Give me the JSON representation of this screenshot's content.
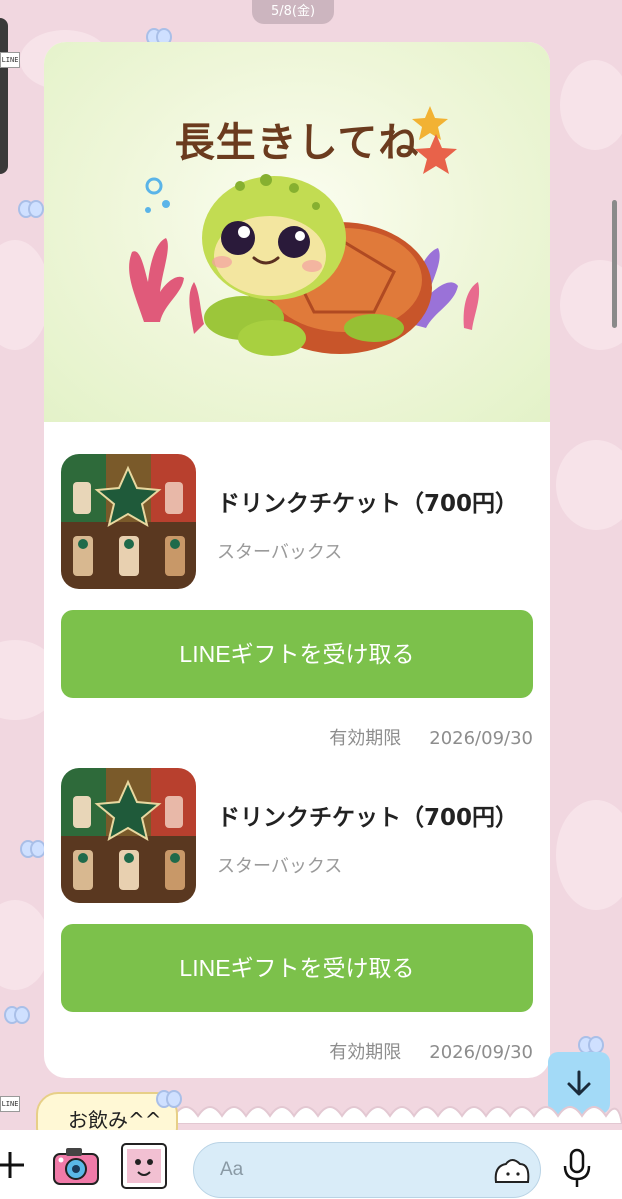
{
  "header": {
    "date": "5/8(金)"
  },
  "side_label": "LINE",
  "card": {
    "hero_title": "長生きしてね",
    "items": [
      {
        "title": "ドリンクチケット（700円）",
        "brand": "スターバックス",
        "button_label": "LINEギフトを受け取る",
        "expiry_label": "有効期限",
        "expiry_date": "2026/09/30"
      },
      {
        "title": "ドリンクチケット（700円）",
        "brand": "スターバックス",
        "button_label": "LINEギフトを受け取る",
        "expiry_label": "有効期限",
        "expiry_date": "2026/09/30"
      }
    ]
  },
  "bubble": {
    "text": "お飲み^^"
  },
  "input": {
    "placeholder": "Aa"
  },
  "colors": {
    "accent_green": "#7cc14b",
    "wallpaper_pink": "#f1d7e0",
    "scroll_button": "#a3daf7"
  },
  "icons": [
    "plus-icon",
    "camera-icon",
    "photo-icon",
    "emoji-icon",
    "mic-icon",
    "arrow-down-icon"
  ]
}
